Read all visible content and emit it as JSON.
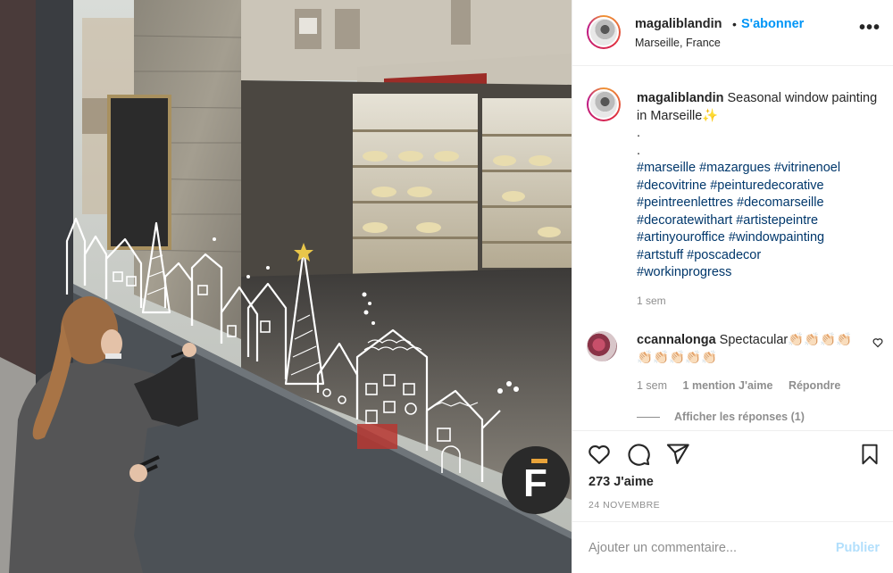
{
  "header": {
    "username": "magaliblandin",
    "separator": "•",
    "follow_label": "S'abonner",
    "location": "Marseille, France",
    "more_icon": "more-horizontal-icon"
  },
  "caption": {
    "username": "magaliblandin",
    "text": "Seasonal window painting in Marseille✨",
    "dot1": ".",
    "dot2": ".",
    "hashtags": [
      "#marseille #mazargues #vitrinenoel",
      "#decovitrine #peinturedecorative",
      "#peintreenlettres #decomarseille",
      "#decoratewithart #artistepeintre",
      "#artinyouroffice #windowpainting",
      "#artstuff #poscadecor",
      "#workinprogress"
    ],
    "time": "1 sem"
  },
  "comment": {
    "username": "ccannalonga",
    "text": "Spectacular👏🏻👏🏻👏🏻👏🏻👏🏻👏🏻👏🏻👏🏻👏🏻",
    "time": "1 sem",
    "likes": "1 mention J'aime",
    "reply": "Répondre",
    "view_replies": "Afficher les réponses (1)"
  },
  "actions": {
    "likes": "273 J'aime",
    "date": "24 NOVEMBRE"
  },
  "add_comment": {
    "placeholder": "Ajouter un commentaire...",
    "publish": "Publier"
  },
  "photo": {
    "sign_letter": "F"
  }
}
